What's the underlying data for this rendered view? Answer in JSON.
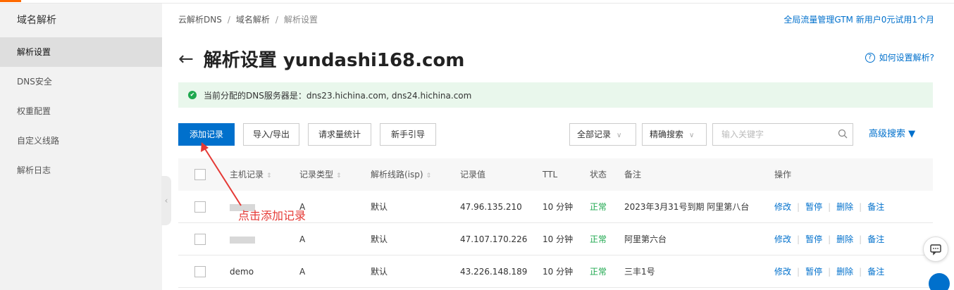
{
  "sidebar": {
    "title": "域名解析",
    "items": [
      {
        "label": "解析设置",
        "active": true
      },
      {
        "label": "DNS安全"
      },
      {
        "label": "权重配置"
      },
      {
        "label": "自定义线路"
      },
      {
        "label": "解析日志"
      }
    ],
    "collapse_icon": "chevron-left-icon"
  },
  "header": {
    "breadcrumb": [
      "云解析DNS",
      "域名解析",
      "解析设置"
    ],
    "promo_link": "全局流量管理GTM 新用户0元试用1个月",
    "title": "解析设置 yundashi168.com",
    "help_link": "如何设置解析?"
  },
  "notice": {
    "text": "当前分配的DNS服务器是：dns23.hichina.com, dns24.hichina.com"
  },
  "toolbar": {
    "add_record": "添加记录",
    "import_export": "导入/导出",
    "request_stats": "请求量统计",
    "guide": "新手引导",
    "record_filter": "全部记录",
    "search_mode": "精确搜索",
    "search_placeholder": "输入关键字",
    "advanced_search": "高级搜索 ▼"
  },
  "table": {
    "headers": {
      "host": "主机记录",
      "type": "记录类型",
      "line": "解析线路(isp)",
      "value": "记录值",
      "ttl": "TTL",
      "status": "状态",
      "remark": "备注",
      "actions": "操作"
    },
    "action_labels": {
      "edit": "修改",
      "pause": "暂停",
      "delete": "删除",
      "note": "备注"
    },
    "rows": [
      {
        "host": "",
        "type": "A",
        "line": "默认",
        "value": "47.96.135.210",
        "ttl": "10 分钟",
        "status": "正常",
        "remark": "2023年3月31号到期 阿里第八台"
      },
      {
        "host": "",
        "type": "A",
        "line": "默认",
        "value": "47.107.170.226",
        "ttl": "10 分钟",
        "status": "正常",
        "remark": "阿里第六台"
      },
      {
        "host": "demo",
        "type": "A",
        "line": "默认",
        "value": "43.226.148.189",
        "ttl": "10 分钟",
        "status": "正常",
        "remark": "三丰1号"
      }
    ]
  },
  "annotation": {
    "text": "点击添加记录",
    "color": "#e53935"
  },
  "colors": {
    "accent": "#0070cc",
    "success": "#1fa84f",
    "brand_orange": "#ff6a00"
  }
}
